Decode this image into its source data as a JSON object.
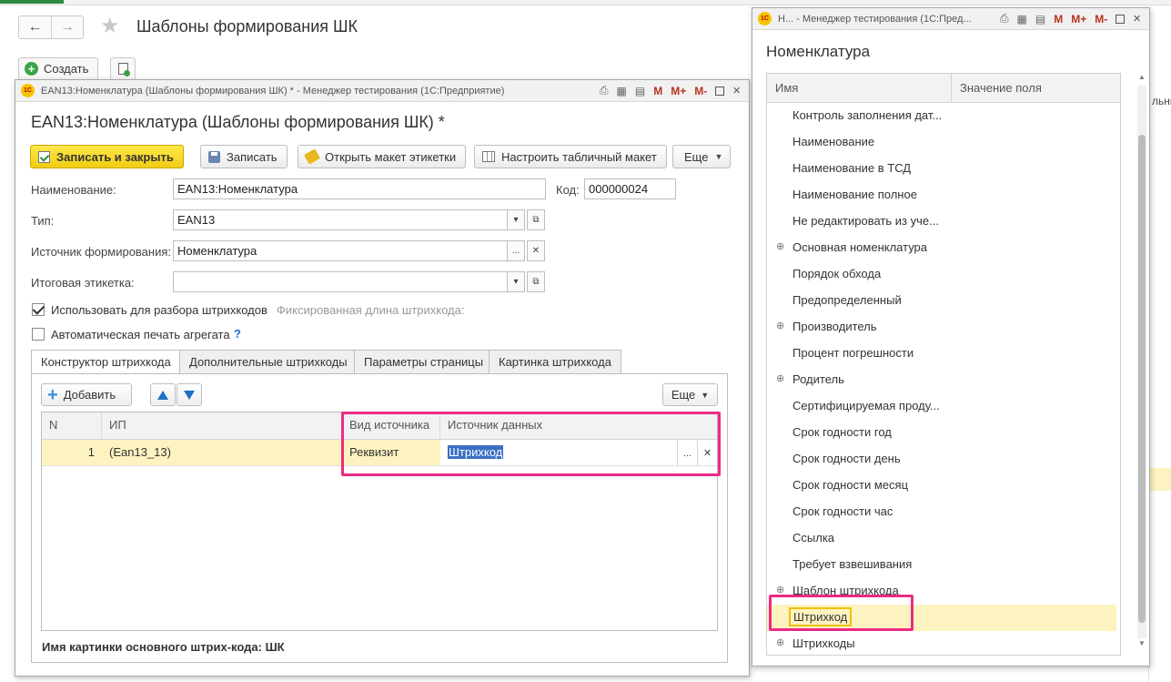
{
  "background": {
    "back_icon": "←",
    "forward_icon": "→",
    "star_icon": "★",
    "title": "Шаблоны формирования ШК",
    "create_label": "Создать",
    "create_icon": "+",
    "right_edge_text": "льны"
  },
  "form_window": {
    "titlebar": "EAN13:Номенклатура (Шаблоны формирования ШК) * - Менеджер тестирования (1С:Предприятие)",
    "logo": "1С",
    "title": "EAN13:Номенклатура (Шаблоны формирования ШК) *",
    "toolbar": {
      "save_close": "Записать и закрыть",
      "save": "Записать",
      "open_label_layout": "Открыть макет этикетки",
      "setup_table_layout": "Настроить табличный макет",
      "more": "Еще"
    },
    "fields": {
      "name_label": "Наименование:",
      "name_value": "EAN13:Номенклатура",
      "code_label": "Код:",
      "code_value": "000000024",
      "type_label": "Тип:",
      "type_value": "EAN13",
      "source_label": "Источник формирования:",
      "source_value": "Номенклатура",
      "final_label_label": "Итоговая этикетка:",
      "final_label_value": "",
      "use_for_parsing_label": "Использовать для разбора штрихкодов",
      "use_for_parsing_checked": true,
      "fixed_length_label": "Фиксированная длина штрихкода:",
      "auto_print_label": "Автоматическая печать агрегата",
      "auto_print_checked": false,
      "help": "?"
    },
    "tabs": [
      {
        "label": "Конструктор штрихкода",
        "active": true
      },
      {
        "label": "Дополнительные штрихкоды",
        "active": false
      },
      {
        "label": "Параметры страницы",
        "active": false
      },
      {
        "label": "Картинка штрихкода",
        "active": false
      }
    ],
    "table_toolbar": {
      "add": "Добавить",
      "more": "Еще"
    },
    "table": {
      "columns": [
        "N",
        "ИП",
        "Вид источника",
        "Источник данных"
      ],
      "rows": [
        {
          "n": "1",
          "ip": "(Ean13_13)",
          "source_kind": "Реквизит",
          "data_source": "Штрихкод"
        }
      ]
    },
    "footer_note": "Имя картинки основного штрих-кода: ШК"
  },
  "pick_window": {
    "titlebar": "Н... - Менеджер тестирования (1С:Пред...",
    "logo": "1С",
    "title": "Номенклатура",
    "columns": [
      "Имя",
      "Значение поля"
    ],
    "items": [
      {
        "label": "Контроль заполнения дат...",
        "expandable": false
      },
      {
        "label": "Наименование",
        "expandable": false
      },
      {
        "label": "Наименование в ТСД",
        "expandable": false
      },
      {
        "label": "Наименование полное",
        "expandable": false
      },
      {
        "label": "Не редактировать из уче...",
        "expandable": false
      },
      {
        "label": "Основная номенклатура",
        "expandable": true
      },
      {
        "label": "Порядок обхода",
        "expandable": false
      },
      {
        "label": "Предопределенный",
        "expandable": false
      },
      {
        "label": "Производитель",
        "expandable": true
      },
      {
        "label": "Процент погрешности",
        "expandable": false
      },
      {
        "label": "Родитель",
        "expandable": true
      },
      {
        "label": "Сертифицируемая проду...",
        "expandable": false
      },
      {
        "label": "Срок годности год",
        "expandable": false
      },
      {
        "label": "Срок годности день",
        "expandable": false
      },
      {
        "label": "Срок годности месяц",
        "expandable": false
      },
      {
        "label": "Срок годности час",
        "expandable": false
      },
      {
        "label": "Ссылка",
        "expandable": false
      },
      {
        "label": "Требует взвешивания",
        "expandable": false
      },
      {
        "label": "Шаблон штрихкода",
        "expandable": true
      },
      {
        "label": "Штрихкод",
        "expandable": false,
        "current": true
      },
      {
        "label": "Штрихкоды",
        "expandable": true
      }
    ]
  },
  "titlebar_buttons": {
    "m": "M",
    "m_plus": "M+",
    "m_minus": "M-",
    "close": "×"
  },
  "colors": {
    "highlight": "#ee2a84",
    "accent_yellow": "#f1cd12",
    "selection_blue": "#3b6fc4",
    "row_yellow": "#fdf3c0"
  }
}
